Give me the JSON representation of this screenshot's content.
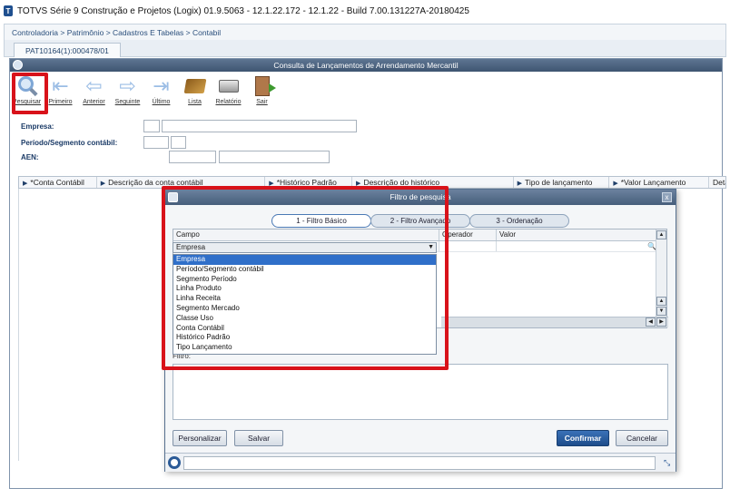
{
  "window": {
    "title": "TOTVS Série 9 Construção e Projetos (Logix) 01.9.5063  -  12.1.22.172 - 12.1.22 - Build 7.00.131227A-20180425",
    "icon_label": "T"
  },
  "breadcrumb": "Controladoria > Patrimônio > Cadastros E Tabelas > Contabil",
  "tab": {
    "label": "PAT10164(1):000478/01"
  },
  "main": {
    "title": "Consulta de Lançamentos de Arrendamento Mercantil"
  },
  "toolbar": {
    "search": "Pesquisar",
    "first": "Primeiro",
    "previous": "Anterior",
    "next": "Seguinte",
    "last": "Último",
    "list": "Lista",
    "report": "Relatório",
    "exit": "Sair"
  },
  "form": {
    "empresa": "Empresa:",
    "periodo": "Período/Segmento contábil:",
    "aen": "AEN:"
  },
  "grid": {
    "columns": [
      "*Conta Contábil",
      "Descrição da conta contábil",
      "*Histórico Padrão",
      "Descrição do histórico",
      "Tipo de lançamento",
      "*Valor Lançamento",
      "Deta"
    ]
  },
  "dialog": {
    "title": "Filtro de pesquisa",
    "close": "x",
    "tabs": [
      "1 - Filtro Básico",
      "2 - Filtro Avançado",
      "3 - Ordenação"
    ],
    "table": {
      "headers": [
        "Campo",
        "Operador",
        "Valor"
      ],
      "selected_field": "Empresa"
    },
    "dropdown": {
      "options": [
        "Empresa",
        "Período/Segmento contábil",
        "Segmento Período",
        "Linha Produto",
        "Linha Receita",
        "Segmento Mercado",
        "Classe Uso",
        "Conta Contábil",
        "Histórico Padrão",
        "Tipo Lançamento"
      ],
      "selected_index": 0
    },
    "filter_label": "Filtro:",
    "buttons": {
      "personalize": "Personalizar",
      "save": "Salvar",
      "confirm": "Confirmar",
      "cancel": "Cancelar"
    }
  },
  "colors": {
    "highlight": "#d8121a",
    "header_blue": "#465e7b",
    "selection": "#2f6fc9"
  }
}
